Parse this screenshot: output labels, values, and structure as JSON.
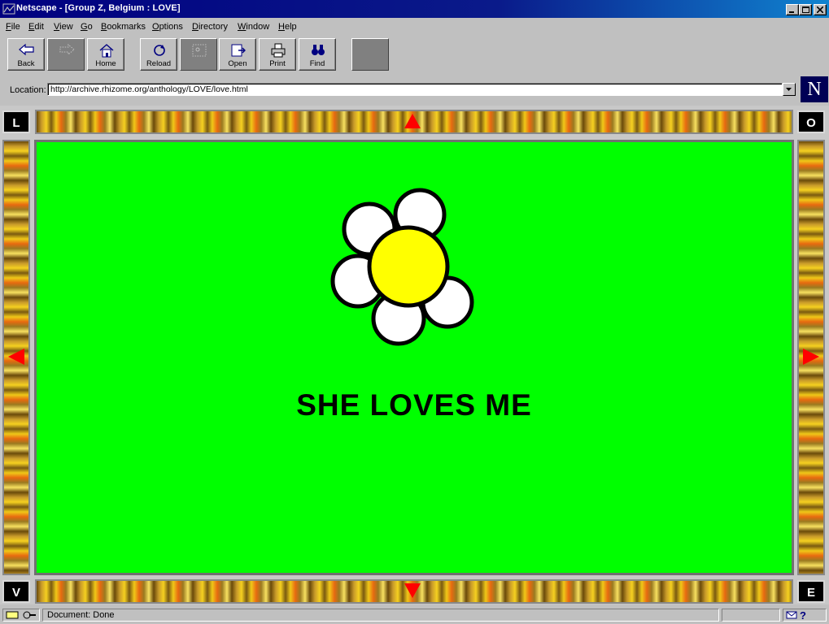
{
  "window": {
    "title": "Netscape - [Group Z, Belgium : LOVE]"
  },
  "menu": {
    "items": [
      {
        "key": "F",
        "rest": "ile"
      },
      {
        "key": "E",
        "rest": "dit"
      },
      {
        "key": "V",
        "rest": "iew"
      },
      {
        "key": "G",
        "rest": "o"
      },
      {
        "key": "B",
        "rest": "ookmarks"
      },
      {
        "key": "O",
        "rest": "ptions"
      },
      {
        "key": "D",
        "rest": "irectory"
      },
      {
        "key": "W",
        "rest": "indow"
      },
      {
        "key": "H",
        "rest": "elp"
      }
    ]
  },
  "toolbar": {
    "back": "Back",
    "home": "Home",
    "reload": "Reload",
    "open": "Open",
    "print": "Print",
    "find": "Find"
  },
  "location": {
    "label": "Location:",
    "url": "http://archive.rhizome.org/anthology/LOVE/love.html"
  },
  "logo": "N",
  "page": {
    "corners": {
      "top_left": "L",
      "top_right": "O",
      "bottom_left": "V",
      "bottom_right": "E"
    },
    "message": "SHE LOVES ME",
    "colors": {
      "background": "#00ff00",
      "petal": "#ffffff",
      "center": "#ffff00",
      "arrow": "#ff0000"
    }
  },
  "status": {
    "text": "Document: Done"
  }
}
